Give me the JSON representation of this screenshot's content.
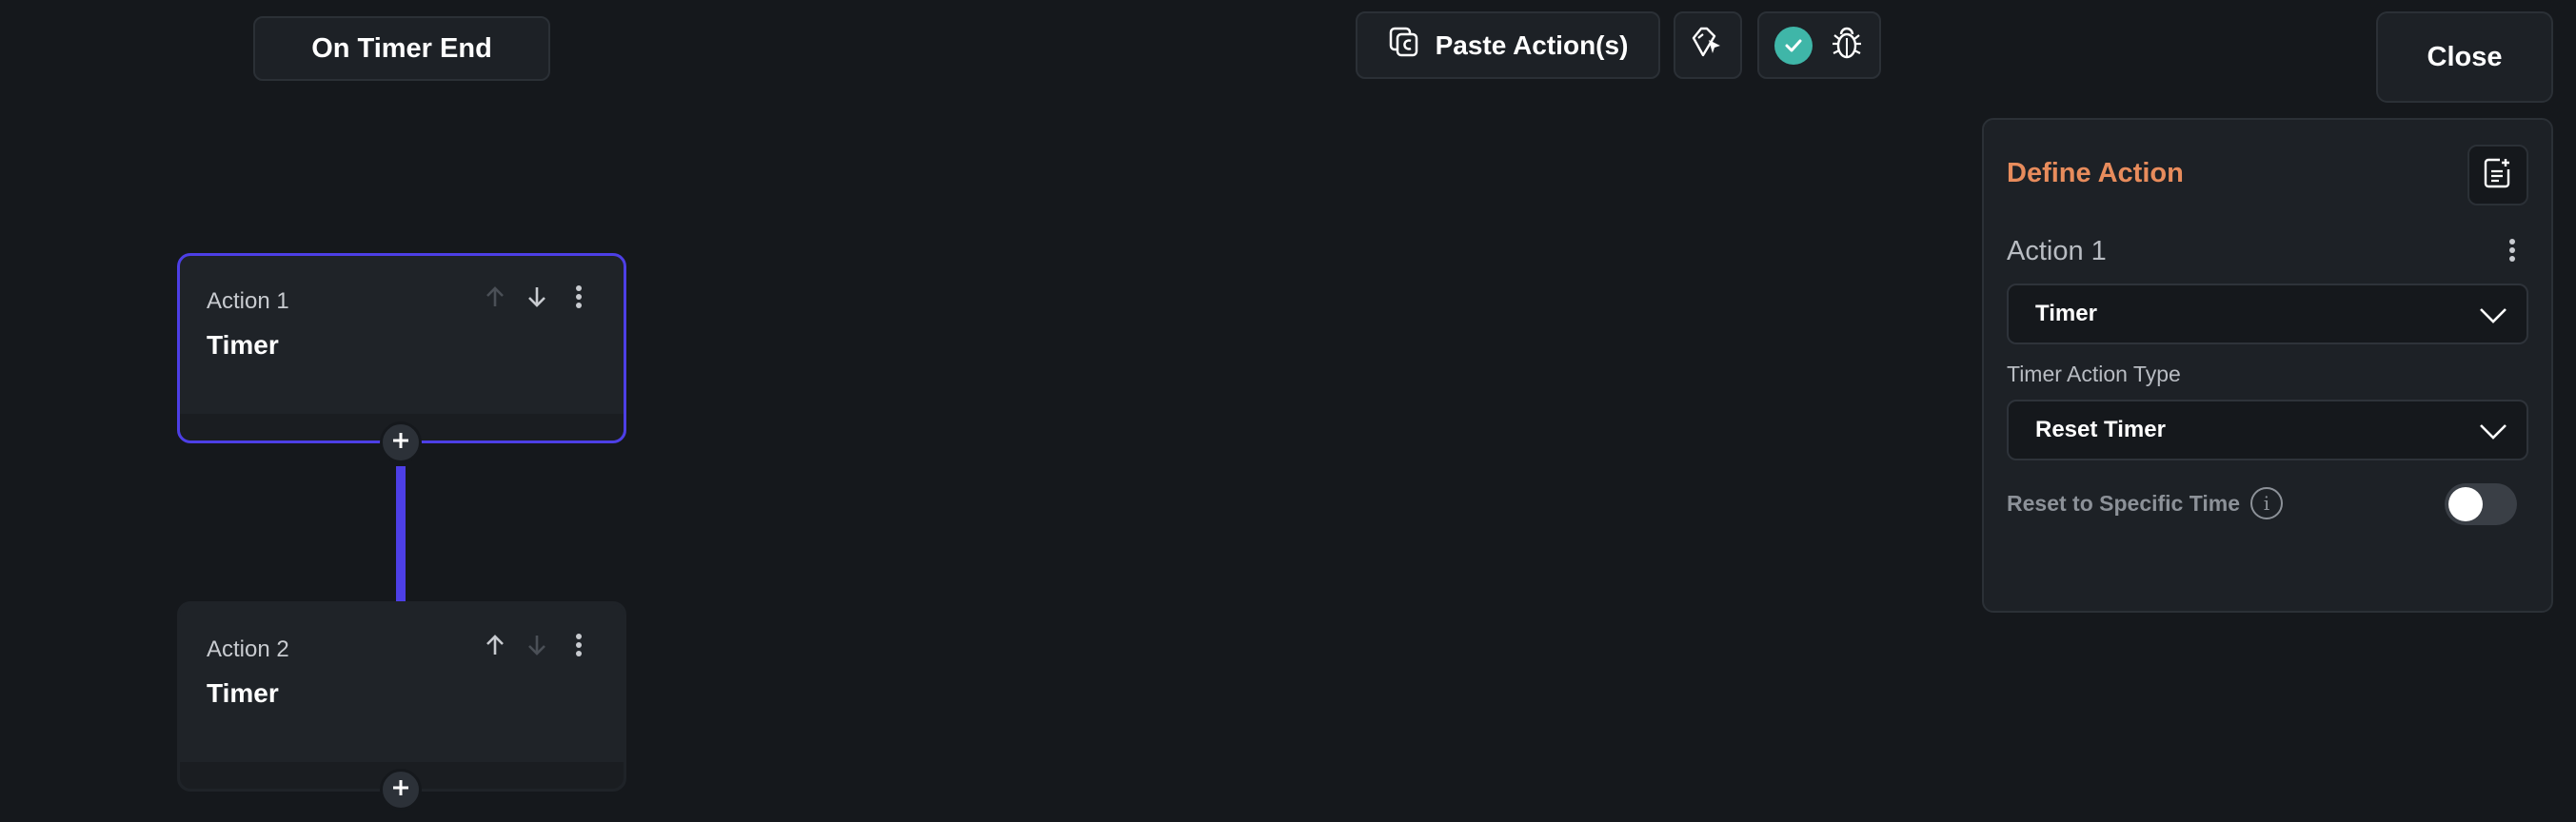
{
  "trigger": {
    "label": "On Timer End"
  },
  "toolbar": {
    "paste_label": "Paste Action(s)",
    "ai_icon": "ai-sparkle-icon",
    "validation_icon": "check-circle-icon",
    "debug_icon": "bug-icon"
  },
  "close_label": "Close",
  "actions": [
    {
      "label": "Action 1",
      "title": "Timer",
      "selected": true
    },
    {
      "label": "Action 2",
      "title": "Timer",
      "selected": false
    }
  ],
  "panel": {
    "title": "Define Action",
    "action_name": "Action 1",
    "action_select": "Timer",
    "timer_action_type_label": "Timer Action Type",
    "timer_action_type_value": "Reset Timer",
    "reset_specific_label": "Reset to Specific Time",
    "reset_specific_enabled": false
  },
  "colors": {
    "background": "#15181c",
    "accent": "#4d3fe6",
    "title_orange": "#e88c5c",
    "success": "#3fb6a8"
  }
}
